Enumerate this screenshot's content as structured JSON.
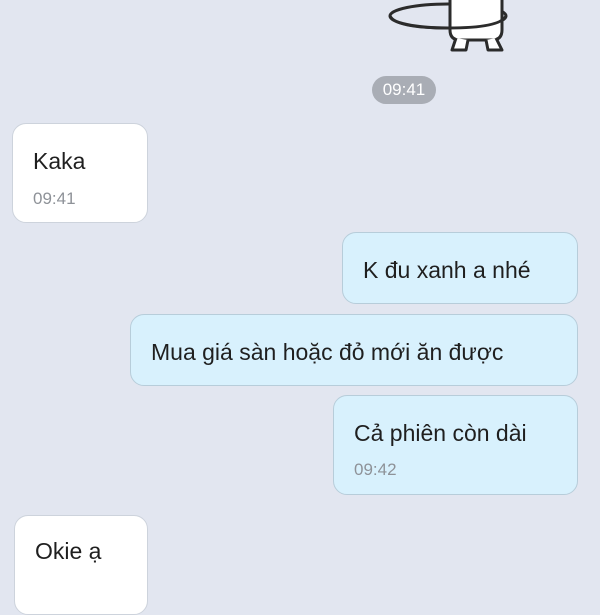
{
  "sticker": {
    "icon": "cat-hula-hoop-sticker-icon"
  },
  "date_divider": {
    "time": "09:41"
  },
  "messages": [
    {
      "direction": "incoming",
      "text": "Kaka",
      "time": "09:41"
    },
    {
      "direction": "outgoing",
      "text": "K đu xanh a nhé",
      "time": ""
    },
    {
      "direction": "outgoing",
      "text": "Mua giá sàn hoặc đỏ mới ăn được",
      "time": ""
    },
    {
      "direction": "outgoing",
      "text": "Cả phiên còn dài",
      "time": "09:42"
    },
    {
      "direction": "incoming",
      "text": "Okie ạ",
      "time": ""
    }
  ],
  "colors": {
    "background": "#e2e6f0",
    "incoming_bubble": "#ffffff",
    "outgoing_bubble": "#d8f1fd",
    "time_pill": "#a9adb5"
  }
}
